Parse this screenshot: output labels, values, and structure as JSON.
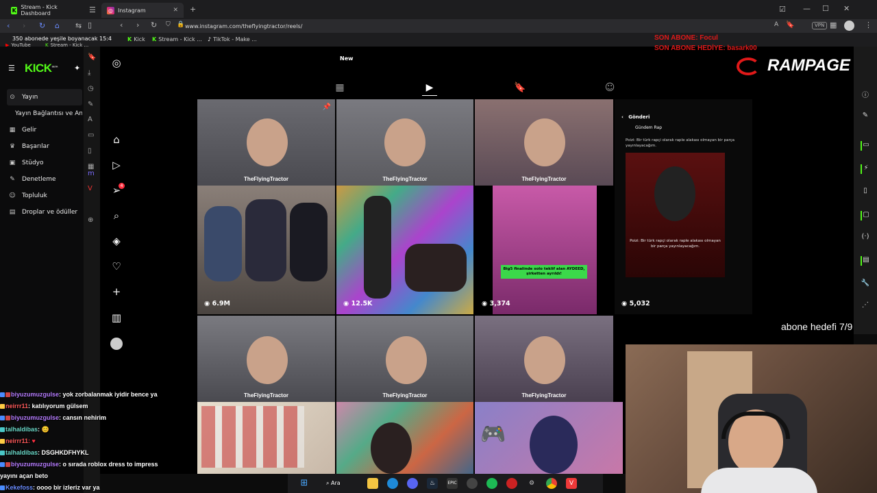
{
  "browser": {
    "tabs": [
      {
        "title": "Stream - Kick Dashboard",
        "active": false
      },
      {
        "title": "Instagram",
        "active": true
      }
    ],
    "url": "www.instagram.com/theflyingtractor/reels/",
    "bookmarks": [
      "YouTube",
      "Stream - Kick ...",
      "Kick",
      "Stream - Kick ...",
      "TikTok - Make ..."
    ],
    "ticker": "350 abonede yeşile boyanacak 15:4"
  },
  "kick": {
    "brand": "KICK",
    "beta": "BETA",
    "menu": [
      {
        "label": "Yayın",
        "icon": "stream-icon",
        "glyph": "(·)"
      },
      {
        "label": "Yayın Bağlantısı ve An",
        "icon": "link-icon",
        "glyph": ""
      },
      {
        "label": "Gelir",
        "icon": "revenue-icon",
        "glyph": "▦"
      },
      {
        "label": "Başarılar",
        "icon": "trophy-icon",
        "glyph": "🏆"
      },
      {
        "label": "Stüdyo",
        "icon": "studio-icon",
        "glyph": "▣"
      },
      {
        "label": "Denetleme",
        "icon": "moderation-icon",
        "glyph": "✎"
      },
      {
        "label": "Topluluk",
        "icon": "community-icon",
        "glyph": "👥"
      },
      {
        "label": "Droplar ve ödüller",
        "icon": "drops-icon",
        "glyph": "▤"
      }
    ]
  },
  "instagram": {
    "new_label": "New",
    "tabs": [
      "posts-tab",
      "reels-tab",
      "saved-tab",
      "tagged-tab"
    ],
    "notification_count": "4",
    "row1": [
      {
        "label": "TheFlyingTractor"
      },
      {
        "label": "TheFlyingTractor"
      },
      {
        "label": "TheFlyingTractor"
      }
    ],
    "row1_views": [
      "6.9M",
      "12.5K",
      "3,374",
      "5,032"
    ],
    "tweet": {
      "header": "Gönderi",
      "account": "Gündem Rap",
      "text": "Poizi: Bir türk rapçi olarak raple alakası olmayan bir parça yayınlayacağım.",
      "caption": "Poizi: Bir türk rapçi olarak raple alakası olmayan bir parça yayınlayacağım."
    },
    "reel3_caption": "Big5 finalinde solo teklif alan AYDEED, şirketten ayrıldı!",
    "row2": [
      {
        "label": "TheFlyingTractor"
      },
      {
        "label": "TheFlyingTractor"
      },
      {
        "label": "TheFlyingTractor"
      }
    ]
  },
  "overlay": {
    "son_abone": "SON ABONE: Focul",
    "son_abone_hediye": "SON ABONE HEDİYE: basark00",
    "rampage": "RAMPAGE",
    "goal": "abone hedefi 7/9"
  },
  "chat": [
    {
      "user": "biyuzumuzgulse",
      "msg": ": yok zorbalanmak iyidir bence ya",
      "color": ""
    },
    {
      "user": "neirrr11",
      "msg": ": katılıyorum gülsem",
      "color": "red"
    },
    {
      "user": "biyuzumuzgulse",
      "msg": ": cansın nehirim",
      "color": ""
    },
    {
      "user": "talhaldibas",
      "msg": ": 😊",
      "color": "cy"
    },
    {
      "user": "neirrr11",
      "msg": ": ♥",
      "color": "red"
    },
    {
      "user": "talhaldibas",
      "msg": ": DSGHKDFHYKL",
      "color": "cy"
    },
    {
      "user": "biyuzumuzgulse",
      "msg": ": o sırada roblox dress to impress",
      "color": ""
    },
    {
      "user": "",
      "msg": "yayını açan beto",
      "color": ""
    },
    {
      "user": "Kekefoss",
      "msg": ": oooo bir izleriz var ya",
      "color": "bl"
    }
  ],
  "taskbar": {
    "search_label": "Ara"
  }
}
